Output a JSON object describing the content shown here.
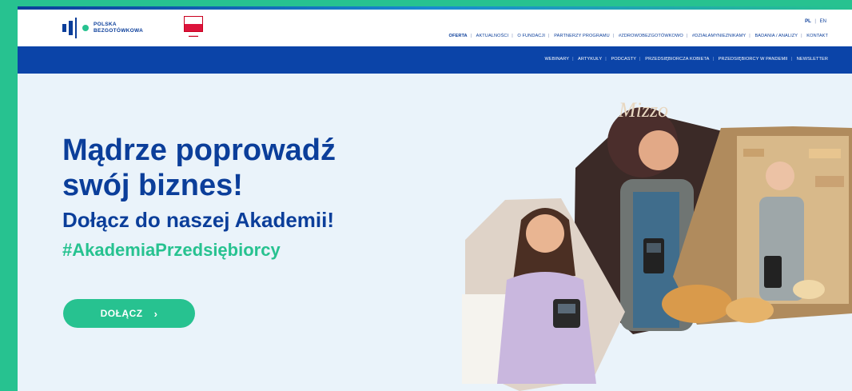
{
  "header": {
    "logo_line1": "POLSKA",
    "logo_line2": "BEZGOTÓWKOWA",
    "lang_active": "PL",
    "lang_sep": "|",
    "lang_other": "EN",
    "nav": [
      "OFERTA",
      "AKTUALNOŚCI",
      "O FUNDACJI",
      "PARTNERZY PROGRAMU",
      "#ZDROWOBEZGOTÓWKOWO",
      "#DZIAŁAMYNIEZNIKAMY",
      "BADANIA / ANALIZY",
      "KONTAKT"
    ]
  },
  "subnav": [
    "WEBINARY",
    "ARTYKUŁY",
    "PODCASTY",
    "PRZEDSIĘBIORCZA KOBIETA",
    "PRZEDSIĘBIORCY W PANDEMII",
    "NEWSLETTER"
  ],
  "hero": {
    "title_line1": "Mądrze poprowadź",
    "title_line2": "swój biznes!",
    "subtitle": "Dołącz do naszej Akademii!",
    "hashtag": "#AkademiaPrzedsiębiorcy",
    "cta_label": "DOŁĄCZ",
    "cta_icon": "›",
    "shop_sign": "Mizzo"
  },
  "colors": {
    "brand_blue": "#0b3e9a",
    "brand_green": "#27c290",
    "hero_bg": "#eaf3fa"
  }
}
